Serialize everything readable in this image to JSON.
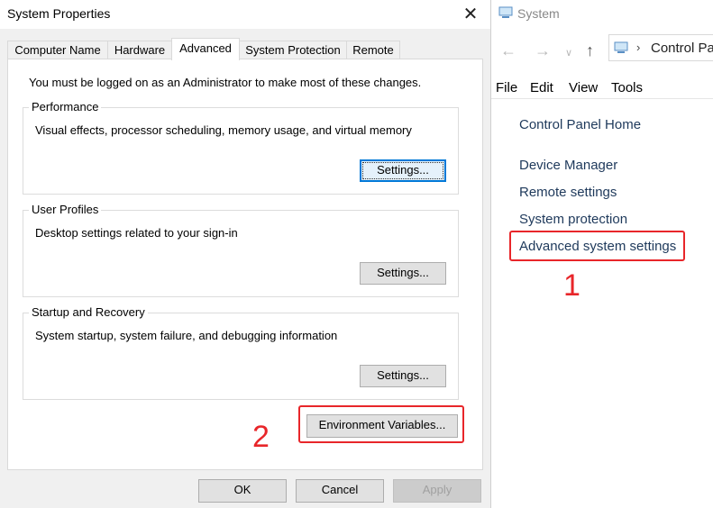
{
  "dialog": {
    "title": "System Properties",
    "tabs": [
      "Computer Name",
      "Hardware",
      "Advanced",
      "System Protection",
      "Remote"
    ],
    "active_tab": "Advanced",
    "admin_note": "You must be logged on as an Administrator to make most of these changes.",
    "performance": {
      "title": "Performance",
      "description": "Visual effects, processor scheduling, memory usage, and virtual memory",
      "button": "Settings..."
    },
    "user_profiles": {
      "title": "User Profiles",
      "description": "Desktop settings related to your sign-in",
      "button": "Settings..."
    },
    "startup_recovery": {
      "title": "Startup and Recovery",
      "description": "System startup, system failure, and debugging information",
      "button": "Settings..."
    },
    "env_button": "Environment Variables...",
    "ok": "OK",
    "cancel": "Cancel",
    "apply": "Apply"
  },
  "control_panel": {
    "title": "System",
    "address": "Control Panel",
    "menu": [
      "File",
      "Edit",
      "View",
      "Tools"
    ],
    "home_link": "Control Panel Home",
    "links": [
      "Device Manager",
      "Remote settings",
      "System protection",
      "Advanced system settings"
    ]
  },
  "annotations": {
    "step1": "1",
    "step2": "2",
    "highlight_color": "#e8262a"
  }
}
